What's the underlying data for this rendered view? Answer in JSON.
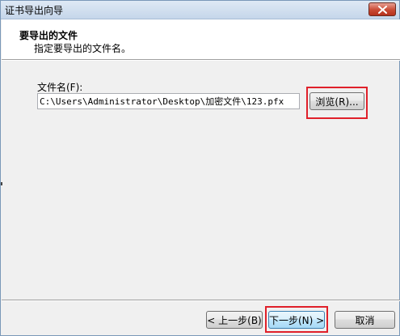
{
  "window": {
    "title": "证书导出向导",
    "close_icon": "close-icon"
  },
  "header": {
    "title": "要导出的文件",
    "subtitle": "指定要导出的文件名。"
  },
  "file": {
    "label": "文件名(F):",
    "value": "C:\\Users\\Administrator\\Desktop\\加密文件\\123.pfx",
    "browse_label": "浏览(R)..."
  },
  "buttons": {
    "back": "< 上一步(B)",
    "next": "下一步(N) >",
    "cancel": "取消"
  },
  "colors": {
    "highlight": "#e0202a",
    "title_bar": "#c5d6ea",
    "close_button": "#c94a34"
  }
}
